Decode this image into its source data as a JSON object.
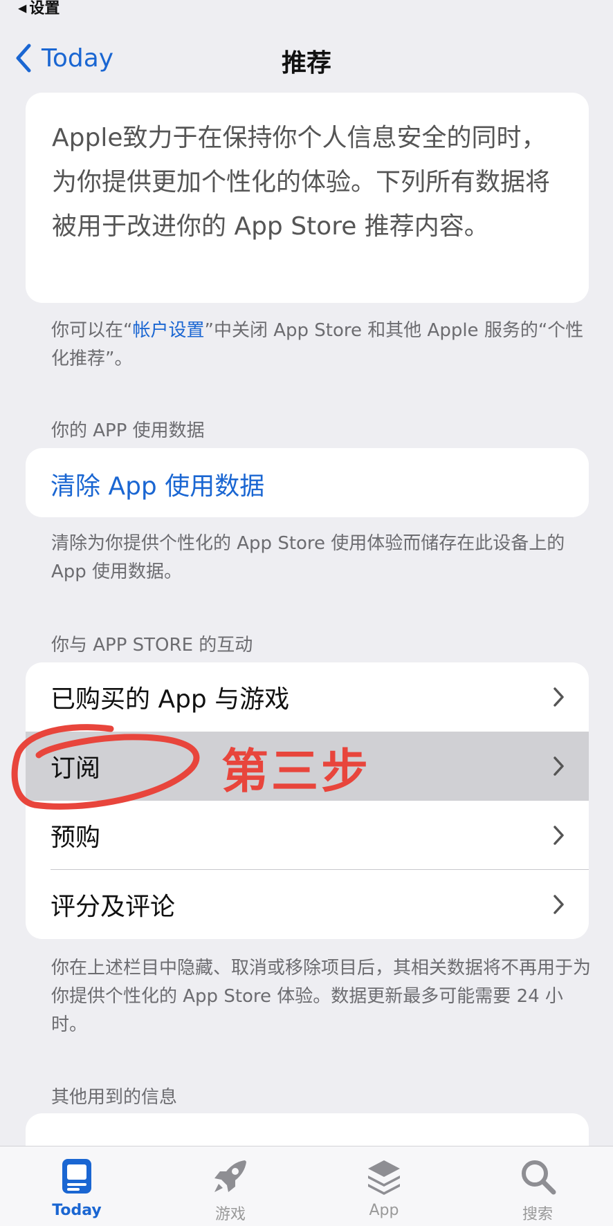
{
  "status_bar": {
    "back_label": "设置"
  },
  "nav": {
    "back_label": "Today",
    "title": "推荐"
  },
  "intro": {
    "text": "Apple致力于在保持你个人信息安全的同时，为你提供更加个性化的体验。下列所有数据将被用于改进你的 App Store 推荐内容。"
  },
  "account_note": {
    "prefix": "你可以在“",
    "link": "帐户设置",
    "suffix": "”中关闭 App Store 和其他 Apple 服务的“个性化推荐”。"
  },
  "app_usage": {
    "header": "你的 APP 使用数据",
    "clear_button": "清除 App 使用数据",
    "footnote": "清除为你提供个性化的 App Store 使用体验而储存在此设备上的 App 使用数据。"
  },
  "interactions": {
    "header": "你与 APP STORE 的互动",
    "rows": [
      {
        "label": "已购买的 App 与游戏"
      },
      {
        "label": "订阅"
      },
      {
        "label": "预购"
      },
      {
        "label": "评分及评论"
      }
    ],
    "footnote": "你在上述栏目中隐藏、取消或移除项目后，其相关数据将不再用于为你提供个性化的 App Store 体验。数据更新最多可能需要 24 小时。"
  },
  "annotation": {
    "text": "第三步",
    "color": "#e8453c"
  },
  "other_info": {
    "header": "其他用到的信息"
  },
  "tabbar": {
    "tabs": [
      {
        "label": "Today",
        "icon": "today-icon",
        "active": true
      },
      {
        "label": "游戏",
        "icon": "rocket-icon",
        "active": false
      },
      {
        "label": "App",
        "icon": "layers-icon",
        "active": false
      },
      {
        "label": "搜索",
        "icon": "search-icon",
        "active": false
      }
    ]
  },
  "colors": {
    "accent": "#1a66d2",
    "background": "#eeeef2",
    "highlight_row": "#d0d0d4"
  }
}
